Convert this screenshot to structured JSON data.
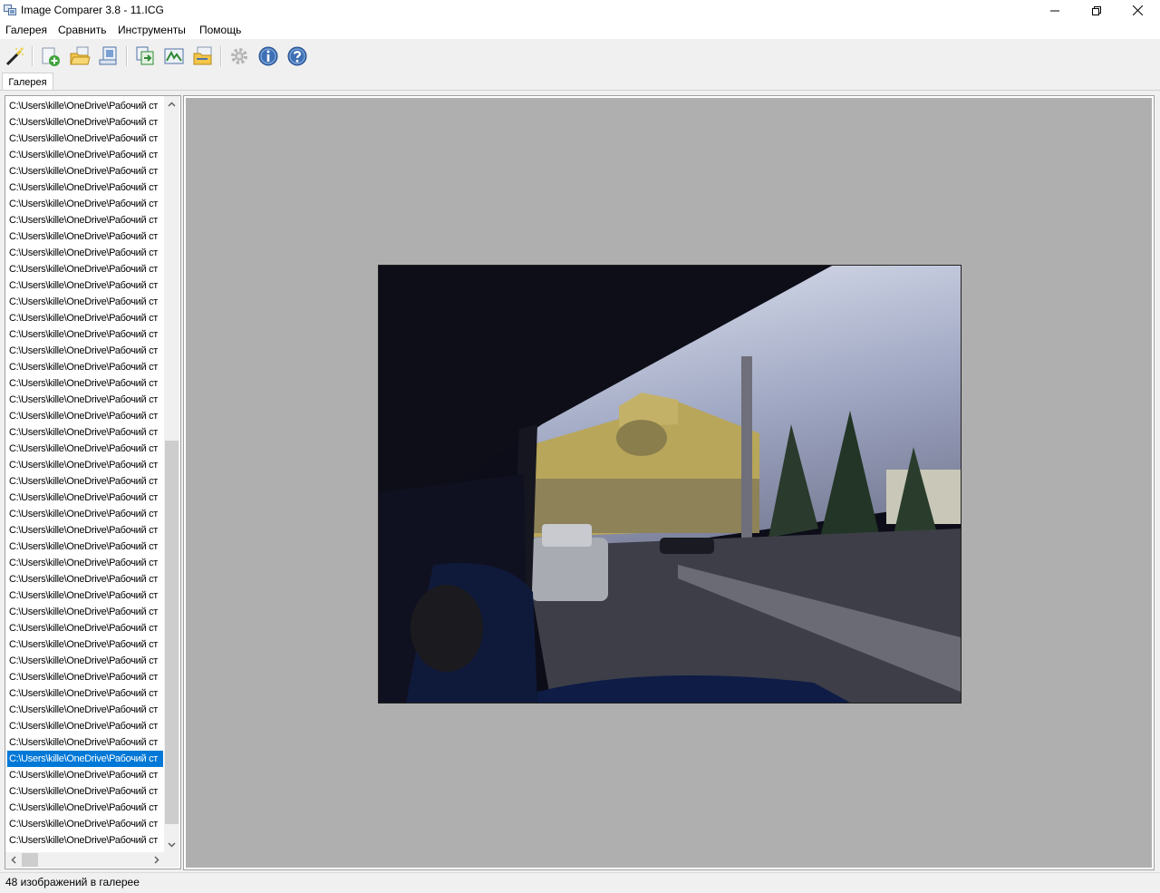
{
  "window": {
    "title": "Image Comparer 3.8 - 11.ICG"
  },
  "menu": {
    "items": [
      "Галерея",
      "Сравнить",
      "Инструменты",
      "Помощь"
    ]
  },
  "toolbar": {
    "icons": [
      "wizard-icon",
      "new-gallery-icon",
      "open-gallery-icon",
      "gallery-properties-icon",
      "compare-icon",
      "compare-pairs-icon",
      "results-icon",
      "settings-icon",
      "info-icon",
      "help-icon"
    ]
  },
  "tabs": [
    {
      "label": "Галерея",
      "active": true
    }
  ],
  "gallery": {
    "rows": [
      "C:\\Users\\kille\\OneDrive\\Рабочий ст",
      "C:\\Users\\kille\\OneDrive\\Рабочий ст",
      "C:\\Users\\kille\\OneDrive\\Рабочий ст",
      "C:\\Users\\kille\\OneDrive\\Рабочий ст",
      "C:\\Users\\kille\\OneDrive\\Рабочий ст",
      "C:\\Users\\kille\\OneDrive\\Рабочий ст",
      "C:\\Users\\kille\\OneDrive\\Рабочий ст",
      "C:\\Users\\kille\\OneDrive\\Рабочий ст",
      "C:\\Users\\kille\\OneDrive\\Рабочий ст",
      "C:\\Users\\kille\\OneDrive\\Рабочий ст",
      "C:\\Users\\kille\\OneDrive\\Рабочий ст",
      "C:\\Users\\kille\\OneDrive\\Рабочий ст",
      "C:\\Users\\kille\\OneDrive\\Рабочий ст",
      "C:\\Users\\kille\\OneDrive\\Рабочий ст",
      "C:\\Users\\kille\\OneDrive\\Рабочий ст",
      "C:\\Users\\kille\\OneDrive\\Рабочий ст",
      "C:\\Users\\kille\\OneDrive\\Рабочий ст",
      "C:\\Users\\kille\\OneDrive\\Рабочий ст",
      "C:\\Users\\kille\\OneDrive\\Рабочий ст",
      "C:\\Users\\kille\\OneDrive\\Рабочий ст",
      "C:\\Users\\kille\\OneDrive\\Рабочий ст",
      "C:\\Users\\kille\\OneDrive\\Рабочий ст",
      "C:\\Users\\kille\\OneDrive\\Рабочий ст",
      "C:\\Users\\kille\\OneDrive\\Рабочий ст",
      "C:\\Users\\kille\\OneDrive\\Рабочий ст",
      "C:\\Users\\kille\\OneDrive\\Рабочий ст",
      "C:\\Users\\kille\\OneDrive\\Рабочий ст",
      "C:\\Users\\kille\\OneDrive\\Рабочий ст",
      "C:\\Users\\kille\\OneDrive\\Рабочий ст",
      "C:\\Users\\kille\\OneDrive\\Рабочий ст",
      "C:\\Users\\kille\\OneDrive\\Рабочий ст",
      "C:\\Users\\kille\\OneDrive\\Рабочий ст",
      "C:\\Users\\kille\\OneDrive\\Рабочий ст",
      "C:\\Users\\kille\\OneDrive\\Рабочий ст",
      "C:\\Users\\kille\\OneDrive\\Рабочий ст",
      "C:\\Users\\kille\\OneDrive\\Рабочий ст",
      "C:\\Users\\kille\\OneDrive\\Рабочий ст",
      "C:\\Users\\kille\\OneDrive\\Рабочий ст",
      "C:\\Users\\kille\\OneDrive\\Рабочий ст",
      "C:\\Users\\kille\\OneDrive\\Рабочий ст",
      "C:\\Users\\kille\\OneDrive\\Рабочий ст",
      "C:\\Users\\kille\\OneDrive\\Рабочий ст",
      "C:\\Users\\kille\\OneDrive\\Рабочий ст",
      "C:\\Users\\kille\\OneDrive\\Рабочий ст",
      "C:\\Users\\kille\\OneDrive\\Рабочий ст",
      "C:\\Users\\kille\\OneDrive\\Рабочий ст"
    ],
    "selected_index": 40,
    "selection_color": "#0078d7"
  },
  "preview": {
    "background": "#afafaf"
  },
  "status": {
    "text": "48 изображений в галерее"
  }
}
